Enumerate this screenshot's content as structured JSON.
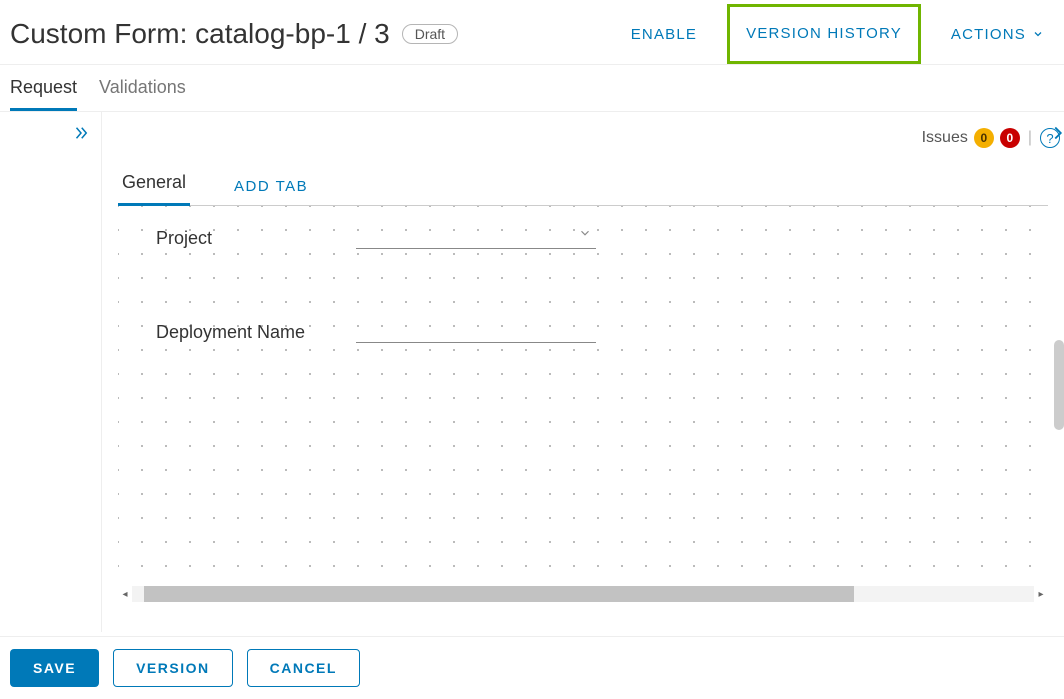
{
  "header": {
    "title": "Custom Form: catalog-bp-1 / 3",
    "status_badge": "Draft",
    "enable_label": "ENABLE",
    "version_history_label": "VERSION HISTORY",
    "actions_label": "ACTIONS"
  },
  "primary_tabs": {
    "request": "Request",
    "validations": "Validations"
  },
  "issues": {
    "label": "Issues",
    "warnings": "0",
    "errors": "0",
    "help": "?"
  },
  "form_tabs": {
    "general": "General",
    "add_tab": "ADD TAB"
  },
  "fields": {
    "project_label": "Project",
    "deployment_name_label": "Deployment Name"
  },
  "footer": {
    "save": "SAVE",
    "version": "VERSION",
    "cancel": "CANCEL"
  }
}
